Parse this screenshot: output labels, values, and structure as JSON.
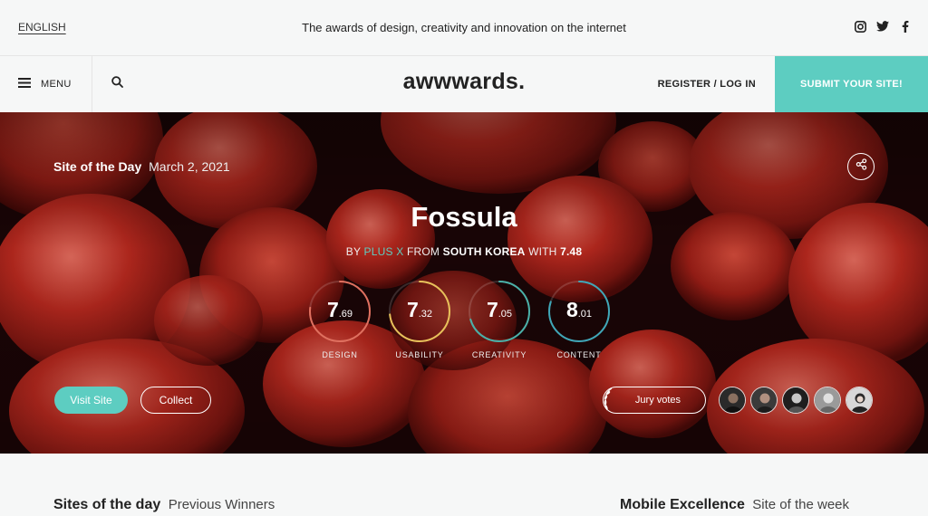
{
  "topbar": {
    "language": "ENGLISH",
    "tagline": "The awards of design, creativity and innovation on the internet",
    "social": [
      "instagram-icon",
      "twitter-icon",
      "facebook-icon"
    ]
  },
  "nav": {
    "menu_label": "MENU",
    "logo": "awwwards.",
    "login_label": "REGISTER / LOG IN",
    "submit_label": "SUBMIT YOUR SITE!"
  },
  "hero": {
    "badge": "Site of the Day",
    "date": "March 2, 2021",
    "site_title": "Fossula",
    "by_label": "BY",
    "author": "PLUS X",
    "from_label": "FROM",
    "country": "SOUTH KOREA",
    "with_label": "WITH",
    "total_score": "7.48",
    "scores": [
      {
        "label": "DESIGN",
        "int": "7",
        "dec": ".69",
        "value": 7.69,
        "color": "#e0705f"
      },
      {
        "label": "USABILITY",
        "int": "7",
        "dec": ".32",
        "value": 7.32,
        "color": "#e8c15a"
      },
      {
        "label": "CREATIVITY",
        "int": "7",
        "dec": ".05",
        "value": 7.05,
        "color": "#4ab0a8"
      },
      {
        "label": "CONTENT",
        "int": "8",
        "dec": ".01",
        "value": 8.01,
        "color": "#3fa7b8"
      }
    ],
    "visit_label": "Visit Site",
    "collect_label": "Collect",
    "jury_label": "Jury votes"
  },
  "bottom": {
    "left_title": "Sites of the day",
    "left_sub": "Previous Winners",
    "right_title": "Mobile Excellence",
    "right_sub": "Site of the week"
  },
  "colors": {
    "accent": "#5dcdc1",
    "hero_red": "#b5281e"
  }
}
